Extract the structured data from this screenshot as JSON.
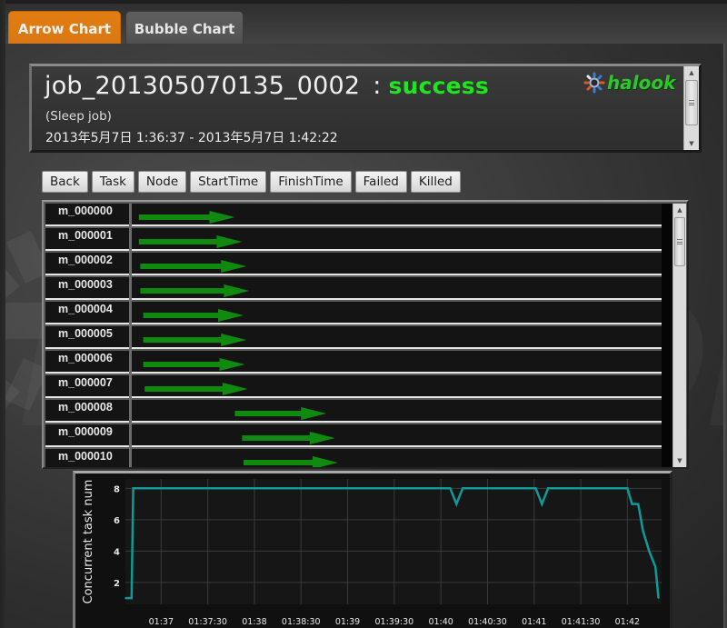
{
  "tabs": [
    {
      "label": "Arrow Chart",
      "active": true
    },
    {
      "label": "Bubble Chart",
      "active": false
    }
  ],
  "job": {
    "id": "job_201305070135_0002",
    "separator": ":",
    "status": "success",
    "status_color": "#1fe51f",
    "name": "(Sleep job)",
    "period": "2013年5月7日 1:36:37 - 2013年5月7日 1:42:22"
  },
  "logo": {
    "text": "halook",
    "icon": "gear-logo-icon"
  },
  "watermark": "halook",
  "toolbar": {
    "buttons": [
      "Back",
      "Task",
      "Node",
      "StartTime",
      "FinishTime",
      "Failed",
      "Killed"
    ]
  },
  "tasks": {
    "arrow_color": "#0f8a0f",
    "time_start": "01:36:37",
    "rows": [
      {
        "label": "m_000000",
        "start_s": 3,
        "end_s": 69
      },
      {
        "label": "m_000001",
        "start_s": 3,
        "end_s": 74
      },
      {
        "label": "m_000002",
        "start_s": 4,
        "end_s": 77
      },
      {
        "label": "m_000003",
        "start_s": 4,
        "end_s": 79
      },
      {
        "label": "m_000004",
        "start_s": 6,
        "end_s": 75
      },
      {
        "label": "m_000005",
        "start_s": 6,
        "end_s": 77
      },
      {
        "label": "m_000006",
        "start_s": 6,
        "end_s": 76
      },
      {
        "label": "m_000007",
        "start_s": 7,
        "end_s": 78
      },
      {
        "label": "m_000008",
        "start_s": 69,
        "end_s": 132
      },
      {
        "label": "m_000009",
        "start_s": 74,
        "end_s": 138
      },
      {
        "label": "m_000010",
        "start_s": 75,
        "end_s": 140
      }
    ]
  },
  "chart_data": {
    "type": "line",
    "title": "",
    "xlabel": "",
    "ylabel": "Concurrent task num",
    "line_color": "#0f9a9a",
    "grid": true,
    "x_unit": "seconds after 01:36:37",
    "xlim": [
      0,
      345
    ],
    "ylim": [
      0.6,
      8.6
    ],
    "yticks": [
      2,
      4,
      6,
      8
    ],
    "xticks": [
      {
        "label": "01:37",
        "t": 23
      },
      {
        "label": "01:37:30",
        "t": 53
      },
      {
        "label": "01:38",
        "t": 83
      },
      {
        "label": "01:38:30",
        "t": 113
      },
      {
        "label": "01:39",
        "t": 143
      },
      {
        "label": "01:39:30",
        "t": 173
      },
      {
        "label": "01:40",
        "t": 203
      },
      {
        "label": "01:40:30",
        "t": 233
      },
      {
        "label": "01:41",
        "t": 263
      },
      {
        "label": "01:41:30",
        "t": 293
      },
      {
        "label": "01:42",
        "t": 323
      }
    ],
    "series": [
      {
        "name": "Concurrent task num",
        "points": [
          [
            0,
            1
          ],
          [
            4,
            1
          ],
          [
            5,
            8
          ],
          [
            209,
            8
          ],
          [
            213,
            7
          ],
          [
            217,
            8
          ],
          [
            264,
            8
          ],
          [
            268,
            7
          ],
          [
            272,
            8
          ],
          [
            323,
            8
          ],
          [
            326,
            7
          ],
          [
            330,
            7
          ],
          [
            333,
            5.3
          ],
          [
            337,
            4
          ],
          [
            341,
            3
          ],
          [
            343,
            1
          ]
        ]
      }
    ]
  }
}
